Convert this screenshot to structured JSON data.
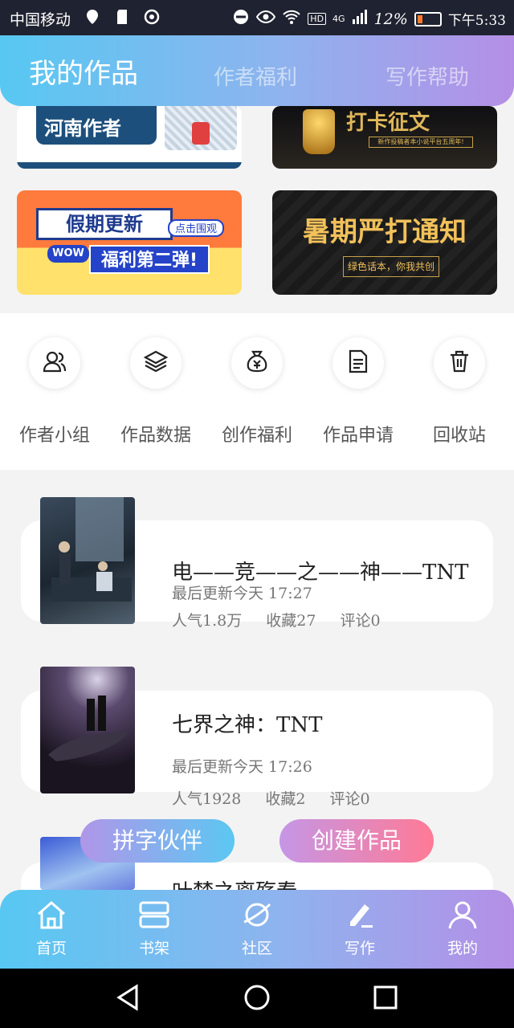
{
  "status_bar": {
    "carrier": "中国移动",
    "network": "4G",
    "hd": "HD",
    "battery": "12%",
    "time": "下午5:33"
  },
  "header": {
    "tabs": [
      {
        "label": "我的作品",
        "active": true
      },
      {
        "label": "作者福利",
        "active": false
      },
      {
        "label": "写作帮助",
        "active": false
      }
    ]
  },
  "banners": {
    "henan": {
      "title": "河南作者"
    },
    "contest": {
      "title": "打卡征文",
      "subtitle": "新作投稿者本小说平台五周年!"
    },
    "holiday": {
      "title": "假期更新",
      "tag_click": "点击围观",
      "tag_wow": "WOW",
      "subtitle": "福利第二弹!"
    },
    "summer": {
      "title": "暑期严打通知",
      "subtitle": "绿色话本，你我共创"
    }
  },
  "quick_actions": [
    {
      "label": "作者小组",
      "icon": "users-icon"
    },
    {
      "label": "作品数据",
      "icon": "layers-icon"
    },
    {
      "label": "创作福利",
      "icon": "money-bag-icon"
    },
    {
      "label": "作品申请",
      "icon": "document-icon"
    },
    {
      "label": "回收站",
      "icon": "trash-icon"
    }
  ],
  "works": [
    {
      "title": "电——竞——之——神——TNT",
      "updated": "最后更新今天 17:27",
      "popularity": "人气1.8万",
      "favorites": "收藏27",
      "comments": "评论0"
    },
    {
      "title": "七界之神：TNT",
      "updated": "最后更新今天 17:26",
      "popularity": "人气1928",
      "favorites": "收藏2",
      "comments": "评论0"
    },
    {
      "title": "叶梦之离殇春"
    }
  ],
  "floating_buttons": {
    "partner": "拼字伙伴",
    "create": "创建作品"
  },
  "bottom_nav": [
    {
      "label": "首页",
      "icon": "home-icon"
    },
    {
      "label": "书架",
      "icon": "bookshelf-icon"
    },
    {
      "label": "社区",
      "icon": "planet-icon"
    },
    {
      "label": "写作",
      "icon": "pen-icon",
      "active": true
    },
    {
      "label": "我的",
      "icon": "user-icon"
    }
  ],
  "colors": {
    "gradient_start": "#57c8f2",
    "gradient_end": "#b48fe6",
    "create_button_end": "#ff7a95"
  }
}
